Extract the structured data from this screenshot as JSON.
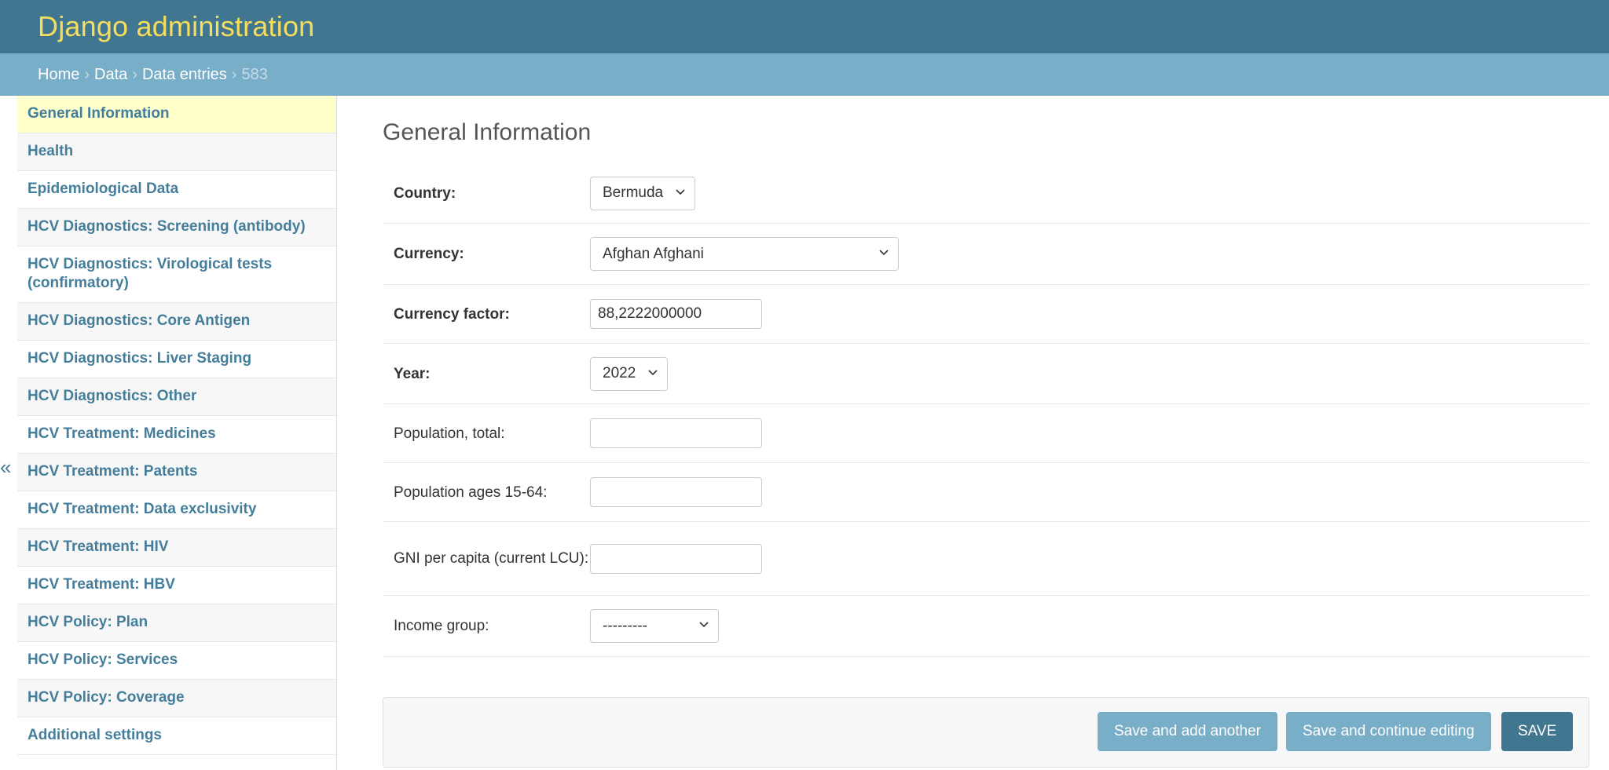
{
  "header": {
    "title": "Django administration"
  },
  "breadcrumbs": {
    "home": "Home",
    "data": "Data",
    "entries": "Data entries",
    "current": "583",
    "separator": "›"
  },
  "nav_toggle": "«",
  "sidebar": {
    "items": [
      {
        "label": "General Information",
        "active": true
      },
      {
        "label": "Health"
      },
      {
        "label": "Epidemiological Data"
      },
      {
        "label": "HCV Diagnostics: Screening (antibody)"
      },
      {
        "label": "HCV Diagnostics: Virological tests (confirmatory)"
      },
      {
        "label": "HCV Diagnostics: Core Antigen"
      },
      {
        "label": "HCV Diagnostics: Liver Staging"
      },
      {
        "label": "HCV Diagnostics: Other"
      },
      {
        "label": "HCV Treatment: Medicines"
      },
      {
        "label": "HCV Treatment: Patents"
      },
      {
        "label": "HCV Treatment: Data exclusivity"
      },
      {
        "label": "HCV Treatment: HIV"
      },
      {
        "label": "HCV Treatment: HBV"
      },
      {
        "label": "HCV Policy: Plan"
      },
      {
        "label": "HCV Policy: Services"
      },
      {
        "label": "HCV Policy: Coverage"
      },
      {
        "label": "Additional settings"
      }
    ]
  },
  "main": {
    "heading": "General Information",
    "fields": {
      "country": {
        "label": "Country:",
        "value": "Bermuda"
      },
      "currency": {
        "label": "Currency:",
        "value": "Afghan Afghani"
      },
      "currency_factor": {
        "label": "Currency factor:",
        "value": "88,2222000000"
      },
      "year": {
        "label": "Year:",
        "value": "2022"
      },
      "population_total": {
        "label": "Population, total:",
        "value": ""
      },
      "population_15_64": {
        "label": "Population ages 15-64:",
        "value": ""
      },
      "gni": {
        "label": "GNI per capita (current LCU):",
        "value": ""
      },
      "income_group": {
        "label": "Income group:",
        "value": "---------"
      }
    }
  },
  "buttons": {
    "save_add": "Save and add another",
    "save_continue": "Save and continue editing",
    "save": "SAVE"
  },
  "colors": {
    "header_bg": "#417690",
    "branding": "#f5dd5d",
    "breadcrumbs_bg": "#79aec8",
    "link": "#447e9b",
    "active_item_bg": "#ffffcc"
  }
}
